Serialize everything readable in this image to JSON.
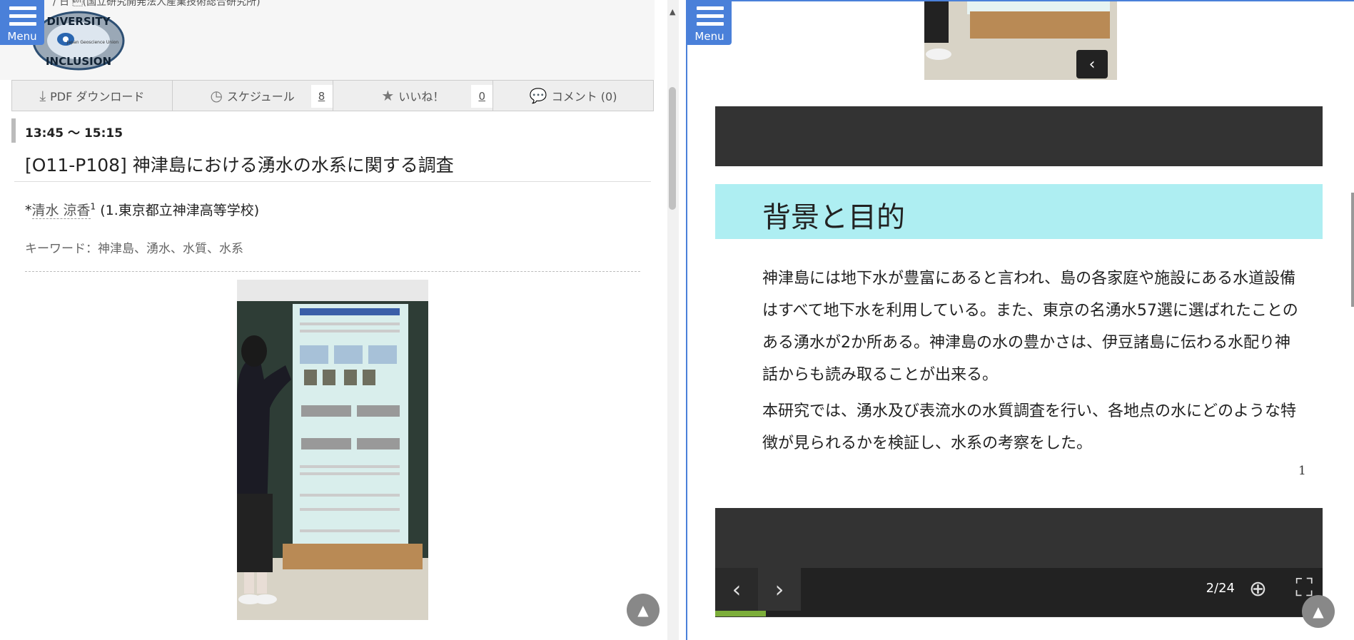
{
  "menu": {
    "label": "Menu"
  },
  "left": {
    "header_text": "/ 日 \u0004(国立研究開発法人産業技術総合研究所)",
    "logo": {
      "line1": "DIVERSITY",
      "line2": "INCLUSION",
      "small": "Japan Geoscience Union"
    },
    "toolbar": {
      "pdf": "PDF ダウンロード",
      "schedule": "スケジュール",
      "schedule_count": "8",
      "like": "いいね！",
      "like_count": "0",
      "comment": "コメント (0)"
    },
    "time": "13:45 〜 15:15",
    "title": "[O11-P108] 神津島における湧水の水系に関する調査",
    "author_prefix": "*",
    "author_name": "清水 涼香",
    "author_sup": "1",
    "author_affil": " (1.東京都立神津高等学校)",
    "keywords": "キーワード：神津島、湧水、水質、水系"
  },
  "right": {
    "slide_heading": "背景と目的",
    "para1": "神津島には地下水が豊富にあると言われ、島の各家庭や施設にある水道設備はすべて地下水を利用している。また、東京の名湧水57選に選ばれたことのある湧水が2か所ある。神津島の水の豊かさは、伊豆諸島に伝わる水配り神話からも読み取ることが出来る。",
    "para2": "本研究では、湧水及び表流水の水質調査を行い、各地点の水にどのような特徴が見られるかを検証し、水系の考察をした。",
    "page_number": "1",
    "viewer": {
      "page": "2/24",
      "progress": 0.0833
    }
  },
  "icons": {
    "prev": "chevron-left-icon",
    "next": "chevron-right-icon",
    "zoom": "zoom-in-icon",
    "fullscreen": "fullscreen-icon",
    "top": "arrow-up-icon"
  },
  "colors": {
    "accent": "#4a80d9",
    "slide_heading_bg": "#aeeef2",
    "progress": "#7cae3a"
  }
}
